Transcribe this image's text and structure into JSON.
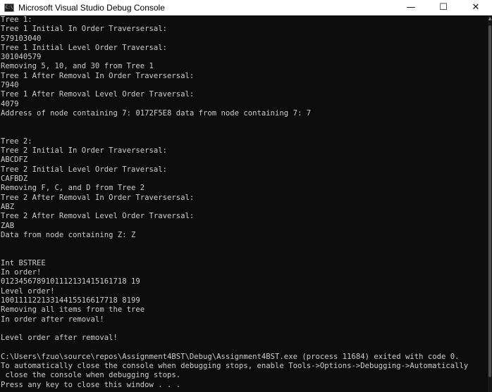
{
  "window": {
    "title": "Microsoft Visual Studio Debug Console",
    "icon": "console-app-icon",
    "icon_glyph": "C:\\",
    "minimize_glyph": "—",
    "maximize_glyph": "☐",
    "close_glyph": "✕"
  },
  "console": {
    "lines": [
      "Tree 1:",
      "Tree 1 Initial In Order Traversersal:",
      "579103040",
      "Tree 1 Initial Level Order Traversal:",
      "301040579",
      "Removing 5, 10, and 30 from Tree 1",
      "Tree 1 After Removal In Order Traversersal:",
      "7940",
      "Tree 1 After Removal Level Order Traversal:",
      "4079",
      "Address of node containing 7: 0172F5E8 data from node containing 7: 7",
      "",
      "",
      "Tree 2:",
      "Tree 2 Initial In Order Traversersal:",
      "ABCDFZ",
      "Tree 2 Initial Level Order Traversal:",
      "CAFBDZ",
      "Removing F, C, and D from Tree 2",
      "Tree 2 After Removal In Order Traversersal:",
      "ABZ",
      "Tree 2 After Removal Level Order Traversal:",
      "ZAB",
      "Data from node containing Z: Z",
      "",
      "",
      "Int BSTREE",
      "In order!",
      "0123456789101112131415161718 19",
      "Level order!",
      "10011112213314415516617718 8199",
      "Removing all items from the tree",
      "In order after removal!",
      "",
      "Level order after removal!",
      "",
      "C:\\Users\\fzuo\\source\\repos\\Assignment4BST\\Debug\\Assignment4BST.exe (process 11684) exited with code 0.",
      "To automatically close the console when debugging stops, enable Tools->Options->Debugging->Automatically",
      " close the console when debugging stops.",
      "Press any key to close this window . . ."
    ]
  },
  "colors": {
    "console_bg": "#0c0c0c",
    "console_fg": "#cccccc",
    "titlebar_bg": "#ffffff"
  }
}
